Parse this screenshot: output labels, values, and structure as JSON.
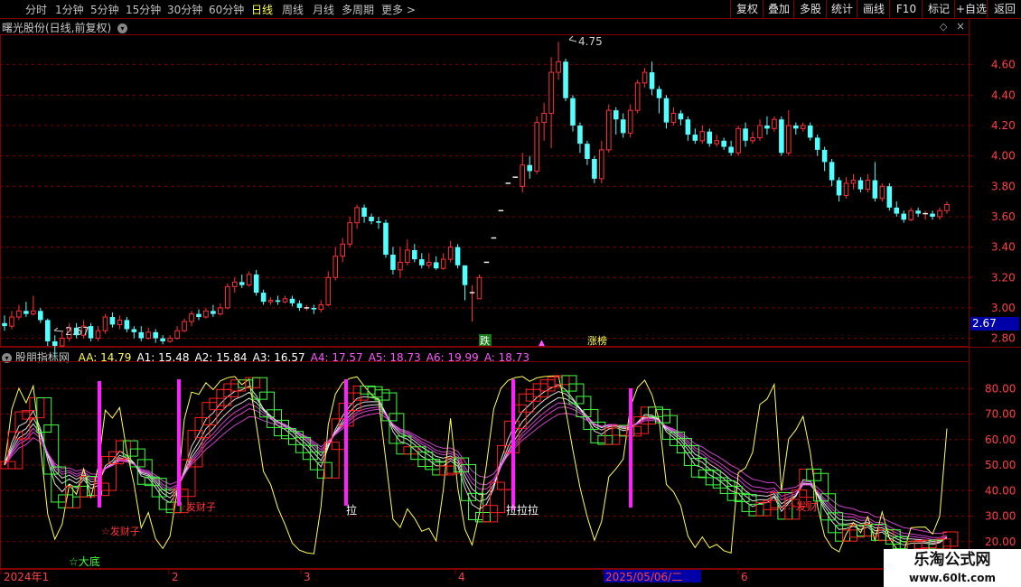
{
  "toolbar": {
    "periods": [
      "分时",
      "1分钟",
      "5分钟",
      "15分钟",
      "30分钟",
      "60分钟",
      "日线",
      "周线",
      "月线",
      "多周期",
      "更多 >"
    ],
    "active": "日线",
    "right_buttons": [
      "复权",
      "叠加",
      "多股",
      "统计",
      "画线",
      "F10",
      "标记",
      "+自选",
      "返回"
    ]
  },
  "main": {
    "title": "曙光股份(日线,前复权)",
    "high_label": "4.75",
    "low_label": "2.67",
    "price_ticks": [
      "4.60",
      "4.40",
      "4.20",
      "4.00",
      "3.80",
      "3.60",
      "3.40",
      "3.20",
      "3.00",
      "2.80"
    ],
    "current_price": "2.67",
    "markers": {
      "die": "跌",
      "zhangbang": "涨榜"
    },
    "colors": {
      "up": "#ff3232",
      "down": "#54ffff",
      "grid": "#800000",
      "bg": "#000000"
    }
  },
  "indicator": {
    "name": "股朋指标网",
    "values": [
      {
        "label": "AA:",
        "value": "14.79",
        "color": "#ffff54"
      },
      {
        "label": "A1:",
        "value": "15.48",
        "color": "#ffffff"
      },
      {
        "label": "A2:",
        "value": "15.84",
        "color": "#ffffff"
      },
      {
        "label": "A3:",
        "value": "16.57",
        "color": "#ffffff"
      },
      {
        "label": "A4:",
        "value": "17.57",
        "color": "#ff54ff"
      },
      {
        "label": "A5:",
        "value": "18.73",
        "color": "#ff54ff"
      },
      {
        "label": "A6:",
        "value": "19.99",
        "color": "#ff54ff"
      },
      {
        "label": "A:",
        "value": "18.73",
        "color": "#ff54ff"
      }
    ],
    "y_ticks": [
      "80.00",
      "70.00",
      "60.00",
      "50.00",
      "40.00",
      "30.00",
      "20.00"
    ],
    "signals": {
      "dadi": "☆大底",
      "facai": "☆发财",
      "facaizi": "☆发财子",
      "la1": "拉",
      "la2": "拉拉拉"
    }
  },
  "timeline": {
    "labels": [
      "2024年1",
      "2",
      "3",
      "4",
      "2025/05/06/二",
      "6"
    ],
    "highlight": "2025/05/06/二"
  },
  "watermark": {
    "title": "乐淘公式网",
    "url": "www.60lt.com"
  },
  "chart_data": {
    "type": "candlestick",
    "title": "曙光股份(日线,前复权)",
    "ylim": [
      2.75,
      4.8
    ],
    "high": 4.75,
    "low": 2.67,
    "candles": [
      [
        2.9,
        2.88,
        2.95,
        2.85
      ],
      [
        2.88,
        2.94,
        2.98,
        2.86
      ],
      [
        2.94,
        2.98,
        3.02,
        2.92
      ],
      [
        2.98,
        2.96,
        3.04,
        2.94
      ],
      [
        2.96,
        2.98,
        3.08,
        2.95
      ],
      [
        2.98,
        2.92,
        3.0,
        2.9
      ],
      [
        2.92,
        2.78,
        2.93,
        2.75
      ],
      [
        2.78,
        2.75,
        2.82,
        2.67
      ],
      [
        2.75,
        2.8,
        2.84,
        2.74
      ],
      [
        2.8,
        2.87,
        2.9,
        2.78
      ],
      [
        2.87,
        2.82,
        2.9,
        2.8
      ],
      [
        2.82,
        2.88,
        2.92,
        2.8
      ],
      [
        2.88,
        2.8,
        2.9,
        2.78
      ],
      [
        2.8,
        2.85,
        2.88,
        2.78
      ],
      [
        2.85,
        2.94,
        2.96,
        2.83
      ],
      [
        2.94,
        2.89,
        2.97,
        2.87
      ],
      [
        2.89,
        2.92,
        2.95,
        2.86
      ],
      [
        2.92,
        2.86,
        2.94,
        2.84
      ],
      [
        2.86,
        2.84,
        2.88,
        2.8
      ],
      [
        2.84,
        2.8,
        2.88,
        2.78
      ],
      [
        2.8,
        2.84,
        2.87,
        2.79
      ],
      [
        2.84,
        2.8,
        2.86,
        2.77
      ],
      [
        2.8,
        2.78,
        2.82,
        2.76
      ],
      [
        2.78,
        2.8,
        2.82,
        2.77
      ],
      [
        2.8,
        2.85,
        2.88,
        2.79
      ],
      [
        2.85,
        2.91,
        2.93,
        2.84
      ],
      [
        2.91,
        2.96,
        2.98,
        2.88
      ],
      [
        2.96,
        2.94,
        2.99,
        2.92
      ],
      [
        2.94,
        2.98,
        3.0,
        2.93
      ],
      [
        2.98,
        2.96,
        3.02,
        2.94
      ],
      [
        2.96,
        3.0,
        3.03,
        2.95
      ],
      [
        3.0,
        3.14,
        3.16,
        2.99
      ],
      [
        3.14,
        3.17,
        3.2,
        3.1
      ],
      [
        3.17,
        3.15,
        3.22,
        3.13
      ],
      [
        3.15,
        3.22,
        3.24,
        3.14
      ],
      [
        3.22,
        3.1,
        3.25,
        3.08
      ],
      [
        3.1,
        3.04,
        3.12,
        3.02
      ],
      [
        3.04,
        3.05,
        3.07,
        3.02
      ],
      [
        3.05,
        3.04,
        3.08,
        3.02
      ],
      [
        3.04,
        3.06,
        3.08,
        3.03
      ],
      [
        3.06,
        3.03,
        3.08,
        3.01
      ],
      [
        3.03,
        3.0,
        3.05,
        2.98
      ],
      [
        3.0,
        3.0,
        3.02,
        2.98
      ],
      [
        3.0,
        2.99,
        3.02,
        2.96
      ],
      [
        2.99,
        3.02,
        3.05,
        2.97
      ],
      [
        3.02,
        3.2,
        3.24,
        3.01
      ],
      [
        3.2,
        3.34,
        3.4,
        3.18
      ],
      [
        3.34,
        3.42,
        3.46,
        3.3
      ],
      [
        3.42,
        3.56,
        3.6,
        3.4
      ],
      [
        3.56,
        3.66,
        3.68,
        3.52
      ],
      [
        3.66,
        3.6,
        3.68,
        3.56
      ],
      [
        3.6,
        3.57,
        3.62,
        3.55
      ],
      [
        3.57,
        3.56,
        3.6,
        3.52
      ],
      [
        3.56,
        3.35,
        3.58,
        3.33
      ],
      [
        3.35,
        3.25,
        3.4,
        3.22
      ],
      [
        3.25,
        3.3,
        3.4,
        3.2
      ],
      [
        3.3,
        3.38,
        3.45,
        3.28
      ],
      [
        3.38,
        3.32,
        3.42,
        3.3
      ],
      [
        3.32,
        3.28,
        3.36,
        3.26
      ],
      [
        3.28,
        3.3,
        3.36,
        3.26
      ],
      [
        3.3,
        3.26,
        3.34,
        3.25
      ],
      [
        3.26,
        3.32,
        3.36,
        3.25
      ],
      [
        3.32,
        3.4,
        3.44,
        3.3
      ],
      [
        3.4,
        3.28,
        3.42,
        3.26
      ],
      [
        3.28,
        3.15,
        3.2,
        3.05
      ],
      [
        3.1,
        3.1,
        3.15,
        2.91
      ],
      [
        3.06,
        3.2,
        3.22,
        3.06
      ],
      [
        3.3,
        3.3,
        3.3,
        3.3
      ],
      [
        3.46,
        3.46,
        3.46,
        3.46
      ],
      [
        3.64,
        3.64,
        3.64,
        3.64
      ],
      [
        3.82,
        3.82,
        3.82,
        3.82
      ],
      [
        3.86,
        3.86,
        3.86,
        3.86
      ],
      [
        3.8,
        3.94,
        4.02,
        3.76
      ],
      [
        3.94,
        3.9,
        4.0,
        3.85
      ],
      [
        3.9,
        4.22,
        4.26,
        3.88
      ],
      [
        4.22,
        4.28,
        4.35,
        4.1
      ],
      [
        4.28,
        4.55,
        4.65,
        4.05
      ],
      [
        4.55,
        4.62,
        4.75,
        4.5
      ],
      [
        4.62,
        4.38,
        4.64,
        4.36
      ],
      [
        4.38,
        4.2,
        4.4,
        4.16
      ],
      [
        4.2,
        4.08,
        4.22,
        4.02
      ],
      [
        4.08,
        3.98,
        4.1,
        3.94
      ],
      [
        3.98,
        3.85,
        4.0,
        3.82
      ],
      [
        3.85,
        4.04,
        4.1,
        3.82
      ],
      [
        4.04,
        4.3,
        4.34,
        4.02
      ],
      [
        4.3,
        4.24,
        4.32,
        4.14
      ],
      [
        4.24,
        4.15,
        4.28,
        4.12
      ],
      [
        4.15,
        4.3,
        4.34,
        4.12
      ],
      [
        4.3,
        4.48,
        4.5,
        4.28
      ],
      [
        4.48,
        4.55,
        4.58,
        4.45
      ],
      [
        4.55,
        4.44,
        4.62,
        4.4
      ],
      [
        4.44,
        4.38,
        4.46,
        4.28
      ],
      [
        4.38,
        4.22,
        4.4,
        4.18
      ],
      [
        4.22,
        4.28,
        4.32,
        4.2
      ],
      [
        4.28,
        4.24,
        4.3,
        4.2
      ],
      [
        4.24,
        4.14,
        4.26,
        4.1
      ],
      [
        4.14,
        4.1,
        4.18,
        4.08
      ],
      [
        4.1,
        4.16,
        4.2,
        4.08
      ],
      [
        4.16,
        4.08,
        4.18,
        4.06
      ],
      [
        4.08,
        4.1,
        4.14,
        4.06
      ],
      [
        4.1,
        4.06,
        4.12,
        4.04
      ],
      [
        4.06,
        4.02,
        4.1,
        4.0
      ],
      [
        4.02,
        4.18,
        4.2,
        4.0
      ],
      [
        4.18,
        4.1,
        4.22,
        4.06
      ],
      [
        4.1,
        4.12,
        4.16,
        4.08
      ],
      [
        4.12,
        4.2,
        4.24,
        4.1
      ],
      [
        4.2,
        4.18,
        4.26,
        4.14
      ],
      [
        4.18,
        4.24,
        4.26,
        4.16
      ],
      [
        4.24,
        4.02,
        4.26,
        4.0
      ],
      [
        4.02,
        4.2,
        4.3,
        4.0
      ],
      [
        4.2,
        4.18,
        4.22,
        4.14
      ],
      [
        4.18,
        4.2,
        4.22,
        4.16
      ],
      [
        4.2,
        4.12,
        4.22,
        4.1
      ],
      [
        4.12,
        4.04,
        4.14,
        4.0
      ],
      [
        4.04,
        3.96,
        4.06,
        3.9
      ],
      [
        3.96,
        3.84,
        3.98,
        3.8
      ],
      [
        3.84,
        3.74,
        3.86,
        3.7
      ],
      [
        3.74,
        3.82,
        3.86,
        3.72
      ],
      [
        3.82,
        3.84,
        3.88,
        3.78
      ],
      [
        3.84,
        3.78,
        3.86,
        3.76
      ],
      [
        3.78,
        3.84,
        3.88,
        3.76
      ],
      [
        3.84,
        3.72,
        3.96,
        3.7
      ],
      [
        3.72,
        3.8,
        3.82,
        3.7
      ],
      [
        3.8,
        3.66,
        3.82,
        3.64
      ],
      [
        3.66,
        3.62,
        3.7,
        3.6
      ],
      [
        3.62,
        3.58,
        3.64,
        3.56
      ],
      [
        3.58,
        3.64,
        3.66,
        3.57
      ],
      [
        3.64,
        3.62,
        3.66,
        3.6
      ],
      [
        3.62,
        3.62,
        3.64,
        3.58
      ],
      [
        3.62,
        3.6,
        3.64,
        3.58
      ],
      [
        3.6,
        3.64,
        3.66,
        3.58
      ],
      [
        3.64,
        3.68,
        3.7,
        3.62
      ]
    ]
  }
}
